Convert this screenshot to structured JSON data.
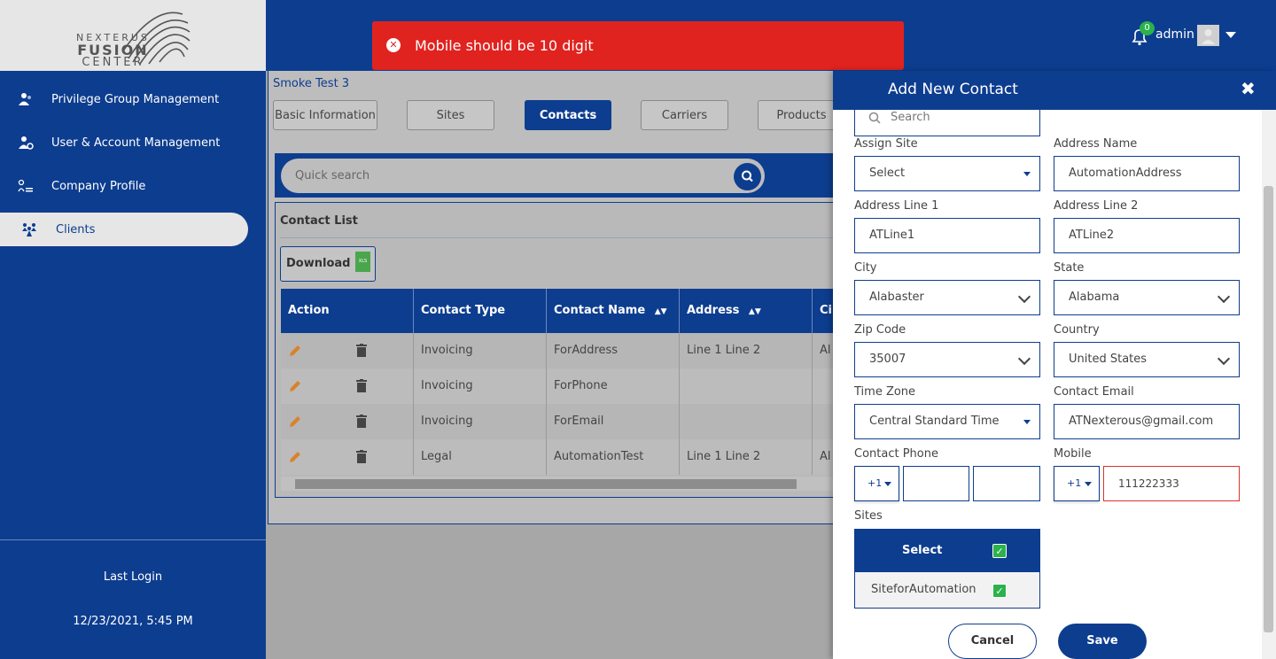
{
  "logo": {
    "line1": "NEXTERUS",
    "line2": "FUSION",
    "line3": "CENTER"
  },
  "sidebar": {
    "items": [
      {
        "label": "Privilege Group Management",
        "icon": "users-group-icon"
      },
      {
        "label": "User & Account Management",
        "icon": "user-gear-icon"
      },
      {
        "label": "Company Profile",
        "icon": "profile-list-icon"
      },
      {
        "label": "Clients",
        "icon": "clients-icon"
      }
    ],
    "active": "Clients",
    "last_login_label": "Last Login",
    "last_login_value": "12/23/2021, 5:45 PM"
  },
  "toast": {
    "message": "Mobile should be 10 digit"
  },
  "header": {
    "user": "admin",
    "notifications": "0"
  },
  "page": {
    "breadcrumb": "Smoke Test 3",
    "tabs": [
      "Basic Information",
      "Sites",
      "Contacts",
      "Carriers",
      "Products"
    ],
    "active_tab": "Contacts",
    "search_placeholder": "Quick search",
    "list_title": "Contact List",
    "download_label": "Download",
    "xls_label": "XLS"
  },
  "table": {
    "columns": [
      "Action",
      "Contact Type",
      "Contact Name",
      "Address",
      "Ci"
    ],
    "rows": [
      {
        "type": "Invoicing",
        "name": "ForAddress",
        "address": "Line 1 Line 2",
        "city": "Al"
      },
      {
        "type": "Invoicing",
        "name": "ForPhone",
        "address": "",
        "city": ""
      },
      {
        "type": "Invoicing",
        "name": "ForEmail",
        "address": "",
        "city": ""
      },
      {
        "type": "Legal",
        "name": "AutomationTest",
        "address": "Line 1 Line 2",
        "city": "Al"
      }
    ]
  },
  "form": {
    "title": "Add New Contact",
    "search_placeholder": "Search",
    "assign_site": {
      "label": "Assign Site",
      "value": "Select"
    },
    "address_name": {
      "label": "Address Name",
      "value": "AutomationAddress"
    },
    "address_line1": {
      "label": "Address Line 1",
      "value": "ATLine1"
    },
    "address_line2": {
      "label": "Address Line 2",
      "value": "ATLine2"
    },
    "city": {
      "label": "City",
      "value": "Alabaster"
    },
    "state": {
      "label": "State",
      "value": "Alabama"
    },
    "zip": {
      "label": "Zip Code",
      "value": "35007"
    },
    "country": {
      "label": "Country",
      "value": "United States"
    },
    "timezone": {
      "label": "Time Zone",
      "value": "Central Standard Time"
    },
    "email": {
      "label": "Contact Email",
      "value": "ATNexterous@gmail.com"
    },
    "phone": {
      "label": "Contact Phone",
      "code": "+1",
      "part1": "",
      "part2": ""
    },
    "mobile": {
      "label": "Mobile",
      "code": "+1",
      "value": "111222333"
    },
    "sites": {
      "label": "Sites",
      "header": "Select",
      "items": [
        "SiteforAutomation"
      ]
    },
    "cancel_label": "Cancel",
    "save_label": "Save"
  },
  "colors": {
    "brand": "#0d3d8f",
    "error": "#e0231f",
    "success": "#2bb24c"
  }
}
